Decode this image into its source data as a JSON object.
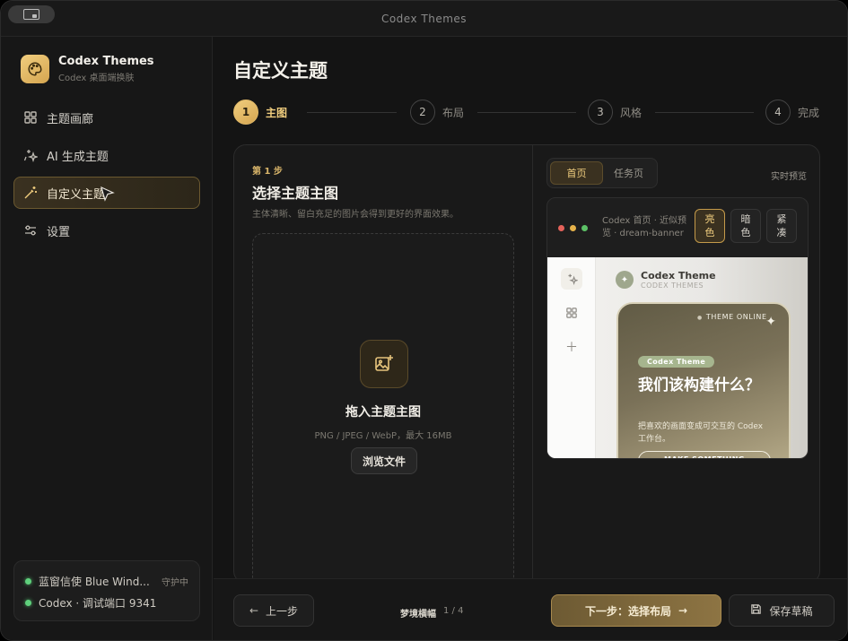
{
  "window": {
    "title": "Codex Themes"
  },
  "sidebar": {
    "brand_title": "Codex Themes",
    "brand_subtitle": "Codex 桌面端换肤",
    "items": [
      {
        "label": "主题画廊",
        "icon": "grid-icon"
      },
      {
        "label": "AI 生成主题",
        "icon": "sparkle-icon"
      },
      {
        "label": "自定义主题",
        "icon": "magic-wand-icon",
        "active": true
      },
      {
        "label": "设置",
        "icon": "sliders-icon"
      }
    ],
    "status": [
      {
        "text": "蓝窗信使 Blue Wind...",
        "state": "守护中"
      },
      {
        "text": "Codex · 调试端口 9341",
        "state": ""
      }
    ]
  },
  "main": {
    "title": "自定义主题",
    "steps": [
      {
        "num": "1",
        "label": "主图",
        "active": true
      },
      {
        "num": "2",
        "label": "布局"
      },
      {
        "num": "3",
        "label": "风格"
      },
      {
        "num": "4",
        "label": "完成"
      }
    ],
    "upload": {
      "step_tag": "第 1 步",
      "heading": "选择主题主图",
      "description": "主体清晰、留白充足的图片会得到更好的界面效果。",
      "drop_title": "拖入主题主图",
      "drop_hint": "PNG / JPEG / WebP，最大 16MB",
      "browse_label": "浏览文件"
    },
    "preview": {
      "tabs": [
        {
          "label": "首页",
          "active": true
        },
        {
          "label": "任务页"
        }
      ],
      "live_label": "实时预览",
      "caption": "Codex 首页 · 近似预览 · dream-banner",
      "modes": [
        {
          "label": "亮色",
          "active": true
        },
        {
          "label": "暗色"
        },
        {
          "label": "紧凑"
        }
      ],
      "app_name": "Codex Theme",
      "app_sub": "CODEX THEMES",
      "hero_online": "THEME ONLINE",
      "hero_pill": "Codex Theme",
      "hero_title": "我们该构建什么？",
      "hero_desc": "把喜欢的画面变成可交互的 Codex 工作台。",
      "hero_cta": "MAKE SOMETHING"
    }
  },
  "footer": {
    "prev_label": "上一步",
    "theme_name": "梦境横幅",
    "progress": "1 / 4",
    "next_label": "下一步：选择布局",
    "save_label": "保存草稿"
  },
  "colors": {
    "accent": "#f0cd7e",
    "status_dot": "#5fd07c",
    "window_bg": "#141414"
  }
}
